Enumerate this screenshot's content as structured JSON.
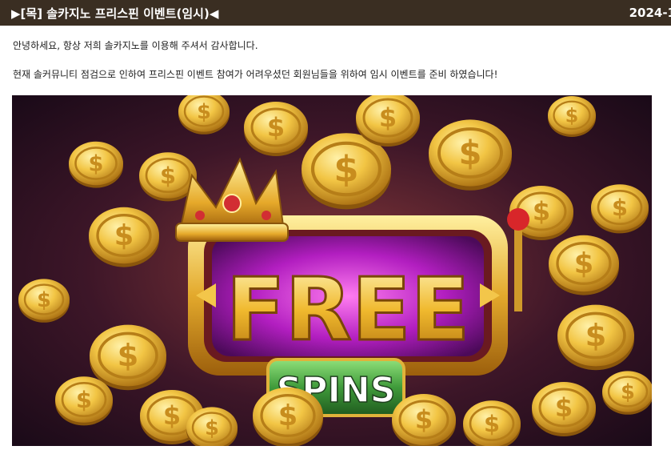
{
  "post": {
    "title": "▶[목] 솔카지노 프리스핀 이벤트(임시)◀",
    "date": "2024-1"
  },
  "body": {
    "paragraph1": "안녕하세요, 항상 저희 솔카지노를 이용해 주셔서 감사합니다.",
    "paragraph2": "현재 솔커뮤니티 점검으로 인하여 프리스핀 이벤트 참여가 어려우셨던 회원님들을 위하여 임시 이벤트를 준비 하였습니다!"
  },
  "banner": {
    "headline": "FREE",
    "subline": "SPINS",
    "coin_symbol": "$"
  },
  "colors": {
    "header_bg": "#3a2e22",
    "gold": "#e9b638",
    "purple": "#b21ec0",
    "green": "#3f9a3a"
  }
}
